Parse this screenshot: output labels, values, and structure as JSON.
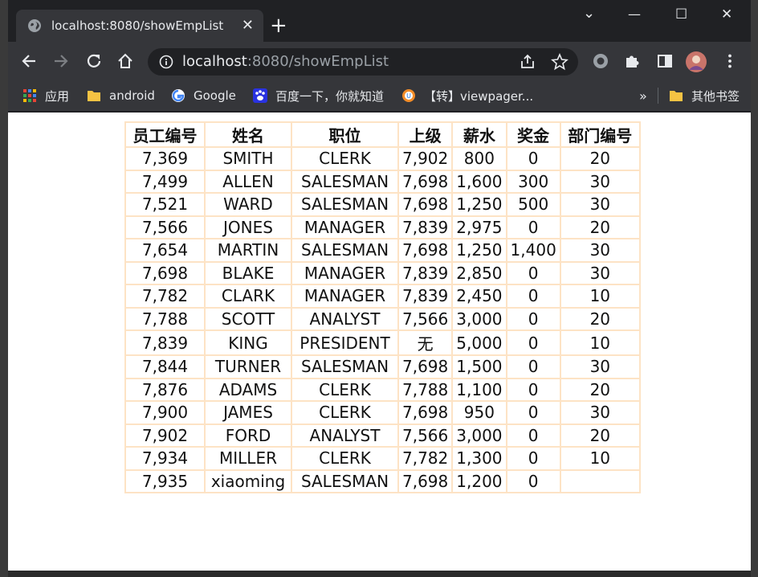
{
  "browser": {
    "tab_title": "localhost:8080/showEmpList",
    "tab_close": "✕",
    "new_tab": "+",
    "url_host": "localhost",
    "url_rest": ":8080/showEmpList",
    "window_controls": {
      "minimize": "—",
      "maximize": "☐",
      "close": "✕",
      "dropdown": "⌄"
    },
    "accent_color": "#35363a"
  },
  "bookmarks": {
    "items": [
      {
        "label": "应用",
        "icon": "apps-grid-icon"
      },
      {
        "label": "android",
        "icon": "folder-icon"
      },
      {
        "label": "Google",
        "icon": "google-icon"
      },
      {
        "label": "百度一下，你就知道",
        "icon": "baidu-icon"
      },
      {
        "label": "【转】viewpager...",
        "icon": "bookmark-site-icon"
      }
    ],
    "overflow": "»",
    "other": "其他书签"
  },
  "table": {
    "headers": [
      "员工编号",
      "姓名",
      "职位",
      "上级",
      "薪水",
      "奖金",
      "部门编号"
    ],
    "rows": [
      [
        "7,369",
        "SMITH",
        "CLERK",
        "7,902",
        "800",
        "0",
        "20"
      ],
      [
        "7,499",
        "ALLEN",
        "SALESMAN",
        "7,698",
        "1,600",
        "300",
        "30"
      ],
      [
        "7,521",
        "WARD",
        "SALESMAN",
        "7,698",
        "1,250",
        "500",
        "30"
      ],
      [
        "7,566",
        "JONES",
        "MANAGER",
        "7,839",
        "2,975",
        "0",
        "20"
      ],
      [
        "7,654",
        "MARTIN",
        "SALESMAN",
        "7,698",
        "1,250",
        "1,400",
        "30"
      ],
      [
        "7,698",
        "BLAKE",
        "MANAGER",
        "7,839",
        "2,850",
        "0",
        "30"
      ],
      [
        "7,782",
        "CLARK",
        "MANAGER",
        "7,839",
        "2,450",
        "0",
        "10"
      ],
      [
        "7,788",
        "SCOTT",
        "ANALYST",
        "7,566",
        "3,000",
        "0",
        "20"
      ],
      [
        "7,839",
        "KING",
        "PRESIDENT",
        "无",
        "5,000",
        "0",
        "10"
      ],
      [
        "7,844",
        "TURNER",
        "SALESMAN",
        "7,698",
        "1,500",
        "0",
        "30"
      ],
      [
        "7,876",
        "ADAMS",
        "CLERK",
        "7,788",
        "1,100",
        "0",
        "20"
      ],
      [
        "7,900",
        "JAMES",
        "CLERK",
        "7,698",
        "950",
        "0",
        "30"
      ],
      [
        "7,902",
        "FORD",
        "ANALYST",
        "7,566",
        "3,000",
        "0",
        "20"
      ],
      [
        "7,934",
        "MILLER",
        "CLERK",
        "7,782",
        "1,300",
        "0",
        "10"
      ],
      [
        "7,935",
        "xiaoming",
        "SALESMAN",
        "7,698",
        "1,200",
        "0",
        ""
      ]
    ]
  }
}
